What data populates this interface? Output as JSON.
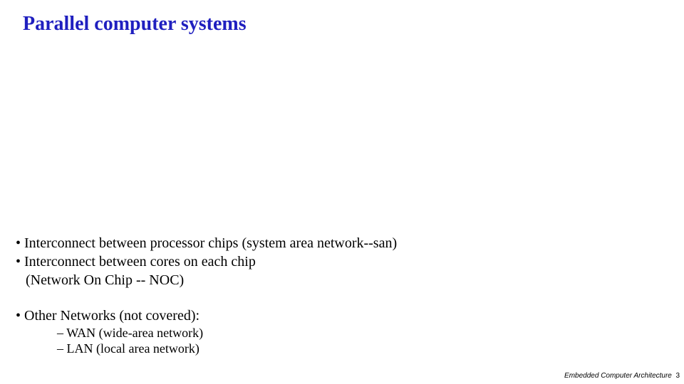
{
  "title": "Parallel computer systems",
  "bullets": [
    {
      "text": "Interconnect between processor chips (system area network--san)"
    },
    {
      "text": "Interconnect between cores on each chip",
      "cont": "(Network On Chip -- NOC)"
    },
    {
      "text": "Other Networks (not covered):",
      "sub": [
        "WAN (wide-area network)",
        "LAN (local area network)"
      ]
    }
  ],
  "footer": {
    "text": "Embedded Computer Architecture",
    "page": "3"
  }
}
